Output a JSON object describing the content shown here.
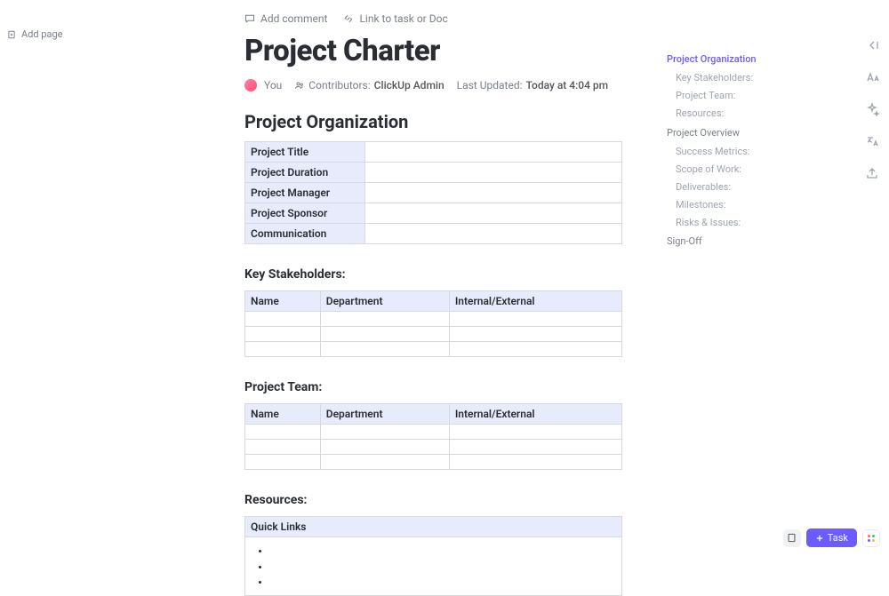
{
  "sidebar": {
    "add_page": "Add page"
  },
  "actions": {
    "add_comment": "Add comment",
    "link_task": "Link to task or Doc"
  },
  "doc": {
    "title": "Project Charter",
    "meta": {
      "you": "You",
      "contributors_label": "Contributors:",
      "contributors_value": "ClickUp Admin",
      "updated_label": "Last Updated:",
      "updated_value": "Today at 4:04 pm"
    },
    "sections": {
      "org": {
        "heading": "Project Organization",
        "rows": [
          "Project Title",
          "Project Duration",
          "Project Manager",
          "Project Sponsor",
          "Communication"
        ]
      },
      "stakeholders": {
        "heading": "Key Stakeholders:",
        "cols": [
          "Name",
          "Department",
          "Internal/External"
        ]
      },
      "team": {
        "heading": "Project Team:",
        "cols": [
          "Name",
          "Department",
          "Internal/External"
        ]
      },
      "resources": {
        "heading": "Resources:",
        "col": "Quick Links"
      }
    }
  },
  "outline": [
    {
      "label": "Project Organization",
      "level": 1,
      "active": true
    },
    {
      "label": "Key Stakeholders:",
      "level": 2
    },
    {
      "label": "Project Team:",
      "level": 2
    },
    {
      "label": "Resources:",
      "level": 2
    },
    {
      "label": "Project Overview",
      "level": 1
    },
    {
      "label": "Success Metrics:",
      "level": 2
    },
    {
      "label": "Scope of Work:",
      "level": 2
    },
    {
      "label": "Deliverables:",
      "level": 2
    },
    {
      "label": "Milestones:",
      "level": 2
    },
    {
      "label": "Risks & Issues:",
      "level": 2
    },
    {
      "label": "Sign-Off",
      "level": 1
    }
  ],
  "bottom": {
    "task": "Task"
  }
}
